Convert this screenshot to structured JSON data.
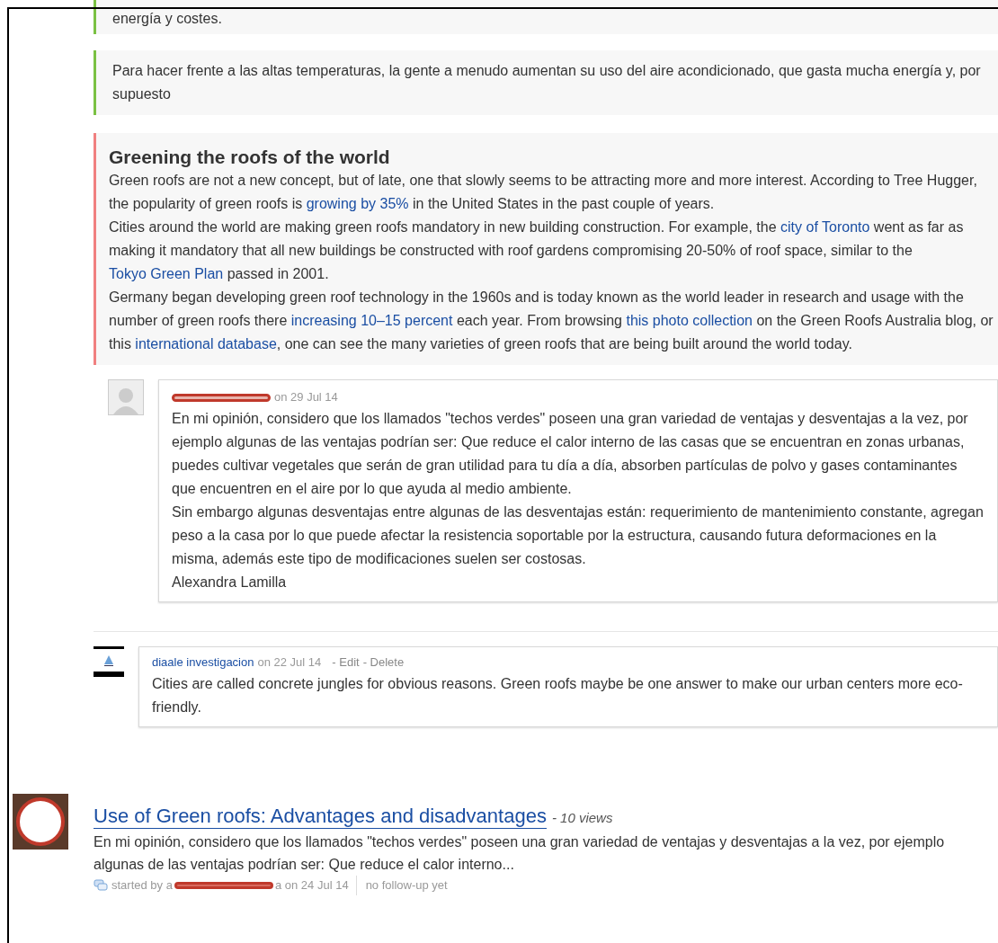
{
  "quotes": [
    {
      "kind": "note",
      "text": "energía y costes."
    },
    {
      "kind": "note",
      "text": "Para hacer frente a las altas temperaturas, la gente a menudo aumentan su uso del aire acondicionado, que gasta mucha energía y, por supuesto"
    }
  ],
  "article": {
    "title": "Greening the roofs of the world",
    "paragraphs": [
      [
        {
          "text": "Green roofs are not a new concept, but of late, one that slowly seems to be attracting more and more interest. According to Tree Hugger, the popularity of green roofs is "
        },
        {
          "link": "growing by 35%"
        },
        {
          "text": " in the United States in the past couple of years."
        }
      ],
      [
        {
          "text": "Cities around the world are making green roofs mandatory in new building construction. For example, the "
        },
        {
          "link": "city of Toronto"
        },
        {
          "text": " went as far as making it mandatory that all new buildings be constructed with roof gardens compromising 20-50% of roof space, similar to the "
        },
        {
          "link": "Tokyo Green Plan"
        },
        {
          "text": " passed in 2001."
        }
      ],
      [
        {
          "text": "Germany began developing green roof technology in the 1960s and is today known as the world leader in research and usage with the number of green roofs there "
        },
        {
          "link": "increasing 10–15 percent"
        },
        {
          "text": " each year. From browsing "
        },
        {
          "link": "this photo collection"
        },
        {
          "text": " on the Green Roofs Australia blog, or this "
        },
        {
          "link": "international database"
        },
        {
          "text": ", one can see the many varieties of green roofs that are being built around the world today."
        }
      ]
    ]
  },
  "comments": [
    {
      "kind": "silhouette",
      "author_redacted": true,
      "date": "on 29 Jul 14",
      "lines": [
        "En mi opinión, considero que los llamados \"techos verdes\" poseen una gran variedad de ventajas y desventajas a la vez, por ejemplo algunas de las ventajas podrían ser: Que reduce el calor interno de las casas que se encuentran en zonas urbanas, puedes cultivar vegetales que serán de gran utilidad para tu día a día, absorben partículas de polvo y gases contaminantes que encuentren en el aire por lo que ayuda al medio ambiente.",
        "Sin embargo algunas desventajas entre algunas de las desventajas están: requerimiento de mantenimiento constante, agregan peso a la casa por lo que puede afectar la resistencia soportable por la estructura, causando futura deformaciones en la misma, además este tipo de modificaciones suelen ser costosas.",
        "Alexandra Lamilla"
      ]
    },
    {
      "kind": "logo",
      "author": "diaale investigacion",
      "date": "on 22 Jul 14",
      "actions": [
        "- Edit",
        "- Delete"
      ],
      "lines": [
        "Cities are called concrete jungles for obvious reasons. Green roofs maybe be one answer to make our urban centers more eco-friendly."
      ]
    }
  ],
  "post": {
    "title": "Use of Green roofs: Advantages and disadvantages",
    "views": "- 10 views",
    "excerpt": "En mi opinión, considero que los llamados \"techos verdes\" poseen una gran variedad de ventajas y desventajas a la vez, por ejemplo algunas de las ventajas podrían ser: Que reduce el calor interno...",
    "started_by": "started by a",
    "started_by_tail": "a on 24 Jul 14",
    "followup": "no follow-up yet"
  }
}
